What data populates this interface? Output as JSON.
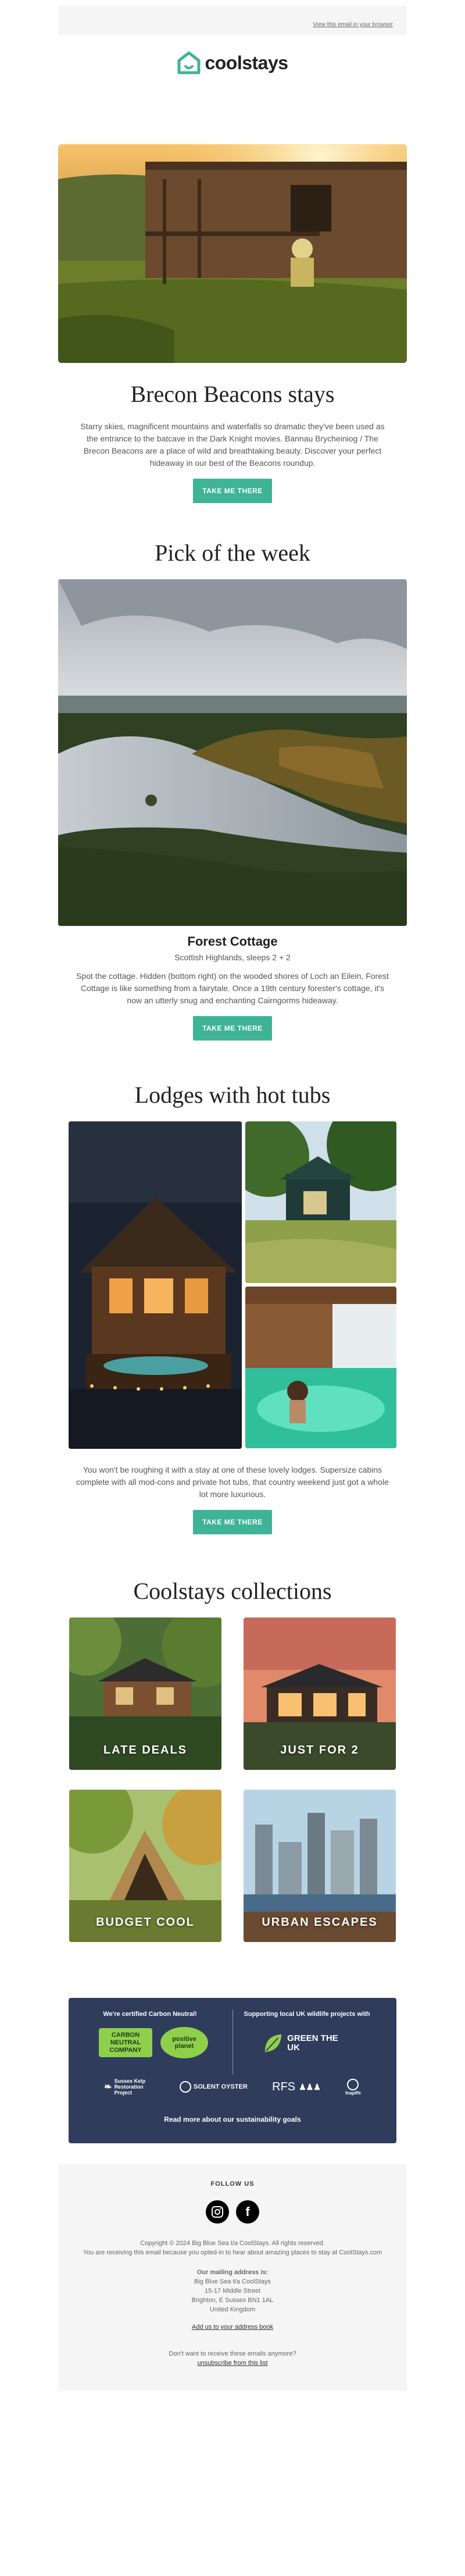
{
  "preheader": {
    "view_in_browser": "View this email in your browser"
  },
  "brand": {
    "name": "coolstays",
    "accent": "#3fb396"
  },
  "hero": {
    "title": "Brecon Beacons stays",
    "body": "Starry skies, magnificent mountains and waterfalls so dramatic they've been used as the entrance to the batcave in the Dark Knight movies. Bannau Brycheiniog / The Brecon Beacons are a place of wild and breathtaking beauty. Discover your perfect hideaway in our best of the Beacons roundup.",
    "cta": "TAKE ME THERE"
  },
  "pick": {
    "heading": "Pick of the week",
    "property_name": "Forest Cottage",
    "property_sub": "Scottish Highlands, sleeps 2 + 2",
    "body": "Spot the cottage. Hidden (bottom right) on the wooded shores of Loch an Eilein, Forest Cottage is like something from a fairytale. Once a 19th century forester's cottage, it's now an utterly snug and enchanting Cairngorms hideaway.",
    "cta": "TAKE ME THERE"
  },
  "lodges": {
    "heading": "Lodges with hot tubs",
    "body": "You won't be roughing it with a stay at one of these lovely lodges. Supersize cabins complete with all mod-cons and private hot tubs, that country weekend just got a whole lot more luxurious.",
    "cta": "TAKE ME THERE"
  },
  "collections": {
    "heading": "Coolstays collections",
    "items": [
      {
        "label": "LATE DEALS"
      },
      {
        "label": "JUST FOR 2"
      },
      {
        "label": "BUDGET COOL"
      },
      {
        "label": "URBAN ESCAPES"
      }
    ]
  },
  "sustainability": {
    "left_title": "We're certified Carbon Neutral!",
    "carbon_badge": "CARBON NEUTRAL COMPANY",
    "positive_badge": "positive planet",
    "right_title": "Supporting local UK wildlife projects with",
    "green_uk": "GREEN THE UK",
    "partners": [
      "Sussex Kelp Restoration Project",
      "SOLENT OYSTER",
      "RFS",
      "bugdfe"
    ],
    "link": "Read more about our sustainability goals"
  },
  "footer": {
    "follow_us": "FOLLOW US",
    "copyright": "Copyright © 2024 Big Blue Sea t/a CoolStays. All rights reserved.",
    "reason": "You are receiving this email because you opted-in to hear about amazing places to stay at CoolStays.com",
    "mailing_title": "Our mailing address is:",
    "address": [
      "Big Blue Sea t/a CoolStays",
      "15-17 Middle Street",
      "Brighton, E Sussex BN1 1AL",
      "United Kingdom"
    ],
    "add_us": "Add us to your address book",
    "unsubscribe_q": "Don't want to receive these emails anymore?",
    "unsubscribe": "unsubscribe from this list"
  }
}
